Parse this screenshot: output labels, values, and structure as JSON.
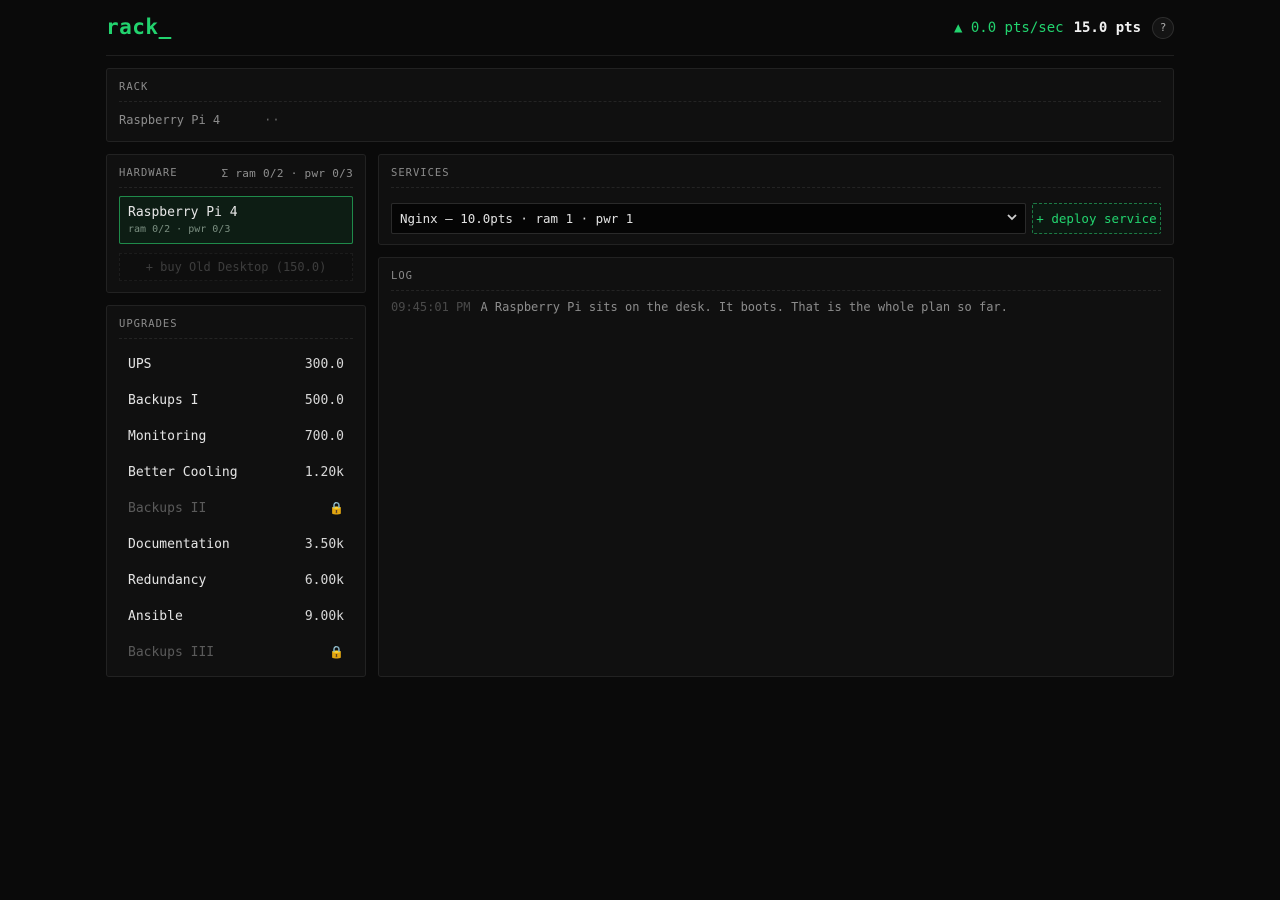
{
  "header": {
    "logo": "rack_",
    "rate": "▲ 0.0 pts/sec",
    "points": "15.0 pts",
    "help": "?"
  },
  "rack": {
    "title": "RACK",
    "item": "Raspberry Pi 4",
    "dots": "··"
  },
  "hardware": {
    "title": "HARDWARE",
    "meta": "Σ ram 0/2 · pwr 0/3",
    "card": {
      "name": "Raspberry Pi 4",
      "sub": "ram 0/2 · pwr 0/3"
    },
    "buy_label": "+ buy Old Desktop (150.0)"
  },
  "upgrades": {
    "title": "UPGRADES",
    "items": [
      {
        "name": "UPS",
        "cost": "300.0"
      },
      {
        "name": "Backups I",
        "cost": "500.0"
      },
      {
        "name": "Monitoring",
        "cost": "700.0"
      },
      {
        "name": "Better Cooling",
        "cost": "1.20k"
      },
      {
        "name": "Backups II",
        "cost": "🔒"
      },
      {
        "name": "Documentation",
        "cost": "3.50k"
      },
      {
        "name": "Redundancy",
        "cost": "6.00k"
      },
      {
        "name": "Ansible",
        "cost": "9.00k"
      },
      {
        "name": "Backups III",
        "cost": "🔒"
      }
    ]
  },
  "services": {
    "title": "SERVICES",
    "selected": "Nginx — 10.0pts · ram 1 · pwr 1",
    "deploy_label": "+ deploy service"
  },
  "log": {
    "title": "LOG",
    "entries": [
      {
        "time": "09:45:01 PM",
        "text": "A Raspberry Pi sits on the desk. It boots. That is the whole plan so far."
      }
    ]
  },
  "colors": {
    "accent": "#22d36e",
    "background": "#0a0a0a",
    "panel": "#101010"
  }
}
